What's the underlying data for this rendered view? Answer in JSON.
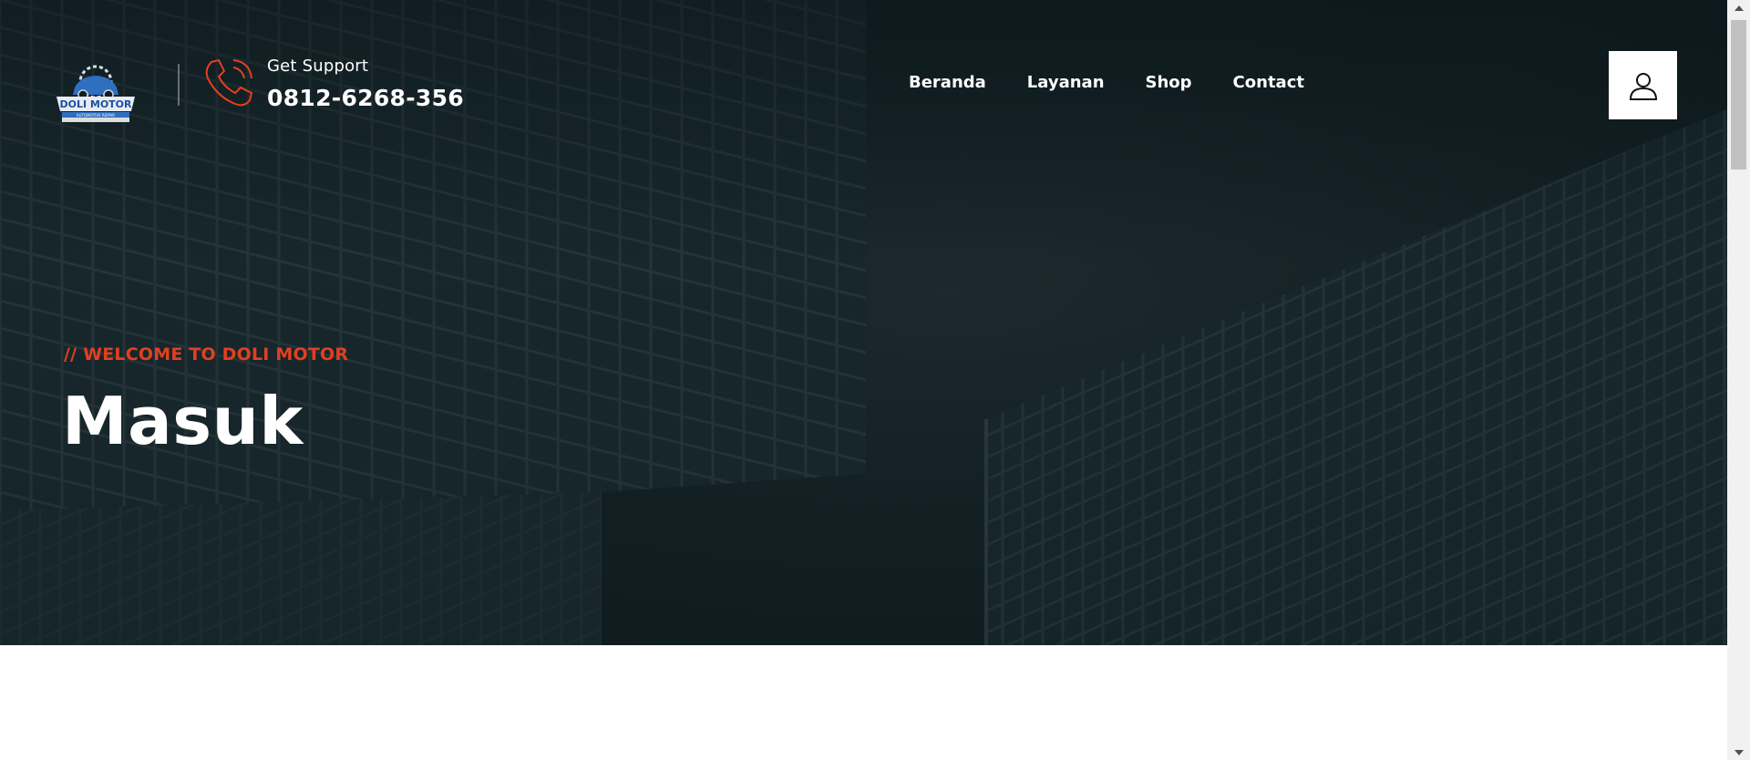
{
  "header": {
    "logo_name": "DOLI MOTOR",
    "logo_tagline": "AUTOMOTIVE REPAIR",
    "support_label": "Get Support",
    "support_phone": "0812-6268-356",
    "phone_icon": "phone-ringing-icon",
    "account_icon": "user-icon"
  },
  "nav": {
    "items": [
      {
        "label": "Beranda"
      },
      {
        "label": "Layanan"
      },
      {
        "label": "Shop"
      },
      {
        "label": "Contact"
      }
    ]
  },
  "hero": {
    "eyebrow": "// WELCOME TO DOLI MOTOR",
    "title": "Masuk"
  },
  "colors": {
    "accent": "#e2401f",
    "hero_bg": "#152226",
    "text_light": "#ffffff"
  }
}
